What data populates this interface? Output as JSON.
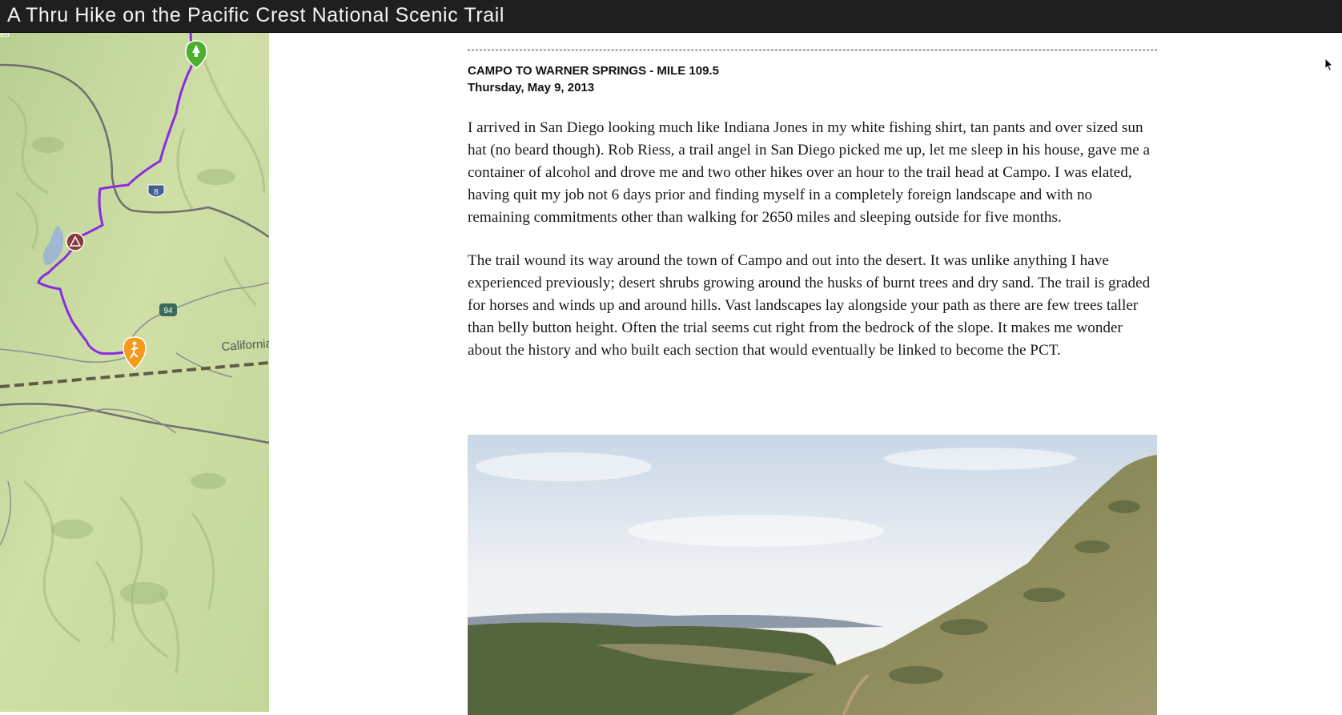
{
  "site": {
    "title": "A Thru Hike on the Pacific Crest National Scenic Trail"
  },
  "map": {
    "state_label": "California",
    "interstate_shield": "8",
    "highway_shield": "94",
    "corner_label": "est",
    "trail_color": "#8a2be2"
  },
  "post": {
    "title": "CAMPO TO WARNER SPRINGS - MILE 109.5",
    "date": "Thursday, May 9, 2013",
    "paragraphs": [
      "I arrived in San Diego looking much like Indiana Jones in my white fishing shirt, tan pants and over sized sun hat (no beard though). Rob Riess, a trail angel in San Diego picked me up, let me sleep in his house, gave me a container of alcohol and drove me and two other hikes over an hour to the trail head at Campo.  I was elated, having quit my job not 6 days prior and finding myself in a completely foreign landscape and with no remaining commitments other than walking for 2650 miles and sleeping outside for five months.",
      "The trail wound its way around the town of Campo and out into the desert.  It was unlike anything I have experienced previously; desert shrubs growing around the husks of burnt trees and dry sand.  The trail is graded for horses and winds up and around hills.  Vast landscapes lay alongside your path as there are few trees taller than belly button height. Often the trial seems cut right from the bedrock of the slope.  It makes me wonder about the history and who built each section that would eventually be linked to become the PCT."
    ]
  }
}
